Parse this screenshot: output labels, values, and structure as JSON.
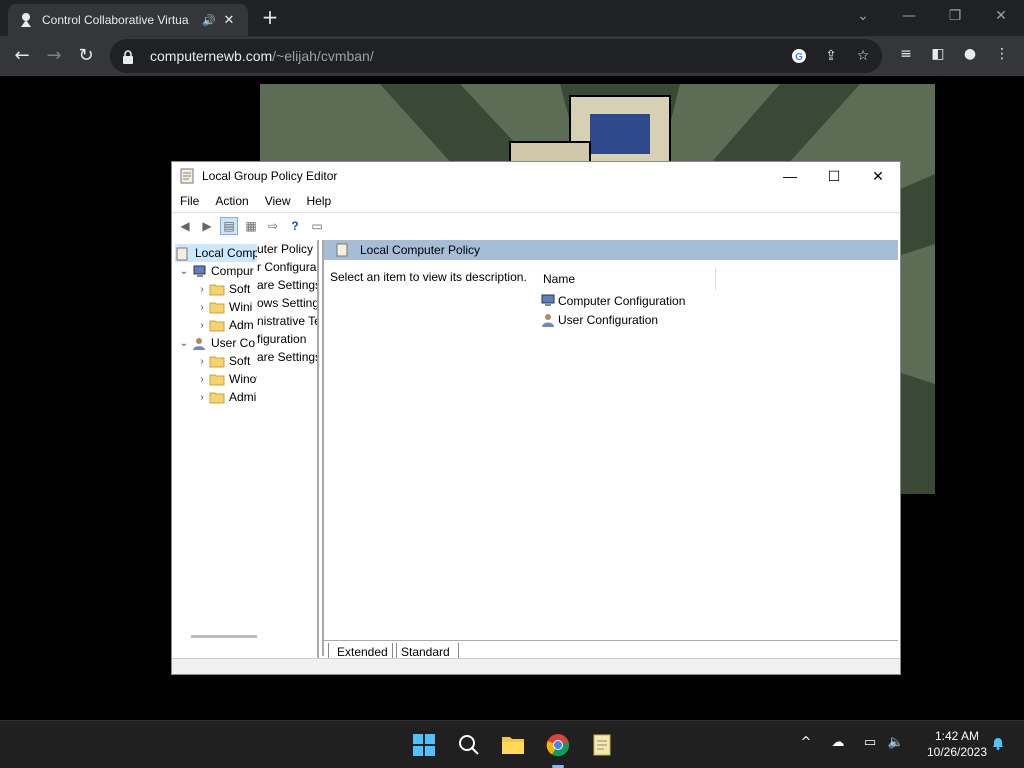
{
  "browser": {
    "tab_title": "Control Collaborative Virtua",
    "url_host": "computernewb.com",
    "url_path": "/~elijah/cvmban/",
    "new_tab_label": "+",
    "minimize_label": "—",
    "restore_label": "❐",
    "close_label": "✕",
    "tab_close_label": "✕"
  },
  "gpo": {
    "title": "Local Group Policy Editor",
    "menu": [
      "File",
      "Action",
      "View",
      "Help"
    ],
    "tree_root": "Local Comp",
    "tree_items": [
      {
        "label": "Compur",
        "indent": 1,
        "expanded": true
      },
      {
        "label": "Soft",
        "indent": 2
      },
      {
        "label": "Wini",
        "indent": 2
      },
      {
        "label": "Adm",
        "indent": 2
      },
      {
        "label": "User Co",
        "indent": 1,
        "expanded": true
      },
      {
        "label": "Soft",
        "indent": 2
      },
      {
        "label": "Winows Setting",
        "indent": 2
      },
      {
        "label": "Admintrative Te",
        "indent": 2
      }
    ],
    "overlay_items": [
      "uter Policy",
      "r Configura",
      "are Settings",
      "ows Setting",
      "nistrative Te",
      "figuration",
      "are Settings"
    ],
    "header_title": "Local Computer Policy",
    "description": "Select an item to view its description.",
    "column_name": "Name",
    "list_items": [
      "Computer Configuration",
      "User Configuration"
    ],
    "tabs": [
      "Extended",
      "Standard"
    ],
    "minimize_label": "—",
    "maximize_label": "☐",
    "close_label": "✕"
  },
  "taskbar": {
    "time": "1:42 AM",
    "date": "10/26/2023"
  },
  "colors": {
    "chrome_dark": "#202124",
    "chrome_toolbar": "#35363a",
    "detail_header": "#a6bdd7",
    "taskbar": "#202020"
  }
}
